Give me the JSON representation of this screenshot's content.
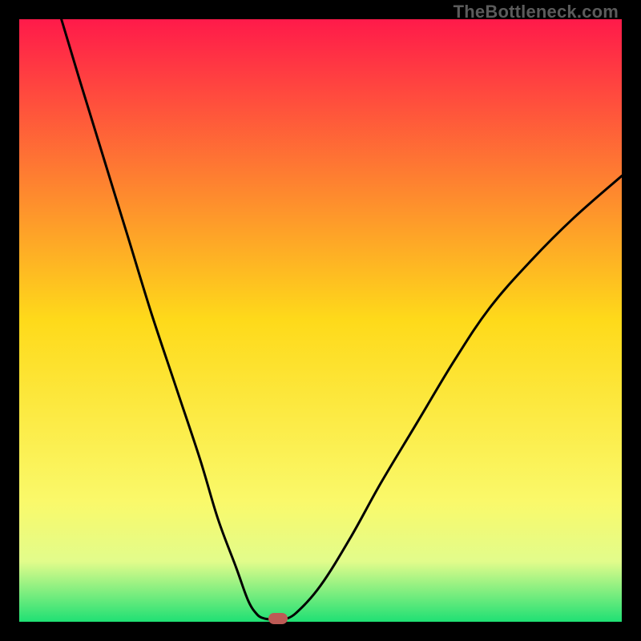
{
  "watermark": "TheBottleneck.com",
  "colors": {
    "bg": "#000000",
    "grad_top": "#ff1a4a",
    "grad_mid": "#feda1a",
    "grad_bottom_inner": "#e2fc8b",
    "grad_bottom": "#1fe074",
    "curve": "#000000",
    "marker": "#bd5a55"
  },
  "chart_data": {
    "type": "line",
    "title": "",
    "xlabel": "",
    "ylabel": "",
    "xlim": [
      0,
      100
    ],
    "ylim": [
      0,
      100
    ],
    "grid": false,
    "legend": false,
    "series": [
      {
        "name": "left-curve",
        "x": [
          7,
          10,
          14,
          18,
          22,
          26,
          30,
          33,
          36,
          38,
          39.5,
          40.5,
          41.5
        ],
        "values": [
          100,
          90,
          77,
          64,
          51,
          39,
          27,
          17,
          9,
          3.5,
          1.2,
          0.6,
          0.4
        ]
      },
      {
        "name": "right-curve",
        "x": [
          44,
          46,
          50,
          55,
          60,
          66,
          72,
          78,
          85,
          92,
          100
        ],
        "values": [
          0.4,
          1.5,
          6,
          14,
          23,
          33,
          43,
          52,
          60,
          67,
          74
        ]
      }
    ],
    "marker": {
      "x": 43,
      "y": 0.5
    },
    "gradient_stops": [
      {
        "offset": 0,
        "color": "#ff1a4a"
      },
      {
        "offset": 50,
        "color": "#feda1a"
      },
      {
        "offset": 80,
        "color": "#faf96a"
      },
      {
        "offset": 90,
        "color": "#e2fc8b"
      },
      {
        "offset": 100,
        "color": "#1fe074"
      }
    ]
  }
}
